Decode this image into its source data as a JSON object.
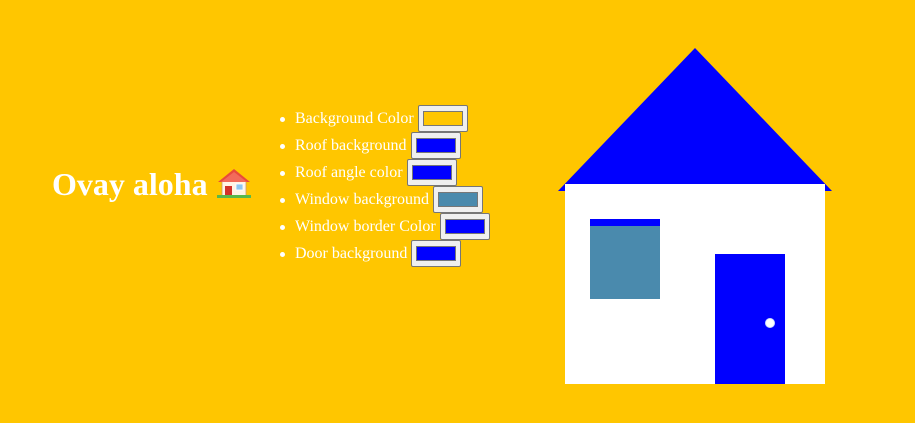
{
  "page": {
    "title": "Ovay aloha"
  },
  "title_icon": "house-with-garden-icon",
  "controls": [
    {
      "label": "Background Color",
      "value": "#ffc600"
    },
    {
      "label": "Roof background",
      "value": "#0000ff"
    },
    {
      "label": "Roof angle color",
      "value": "#0000ff"
    },
    {
      "label": "Window background",
      "value": "#4a8aad"
    },
    {
      "label": "Window border Color",
      "value": "#0000ff"
    },
    {
      "label": "Door background",
      "value": "#0000ff"
    }
  ],
  "colors": {
    "roof": "#0000ff",
    "window": "#4a8aad",
    "window_border": "#0000ff",
    "door": "#0000ff"
  }
}
